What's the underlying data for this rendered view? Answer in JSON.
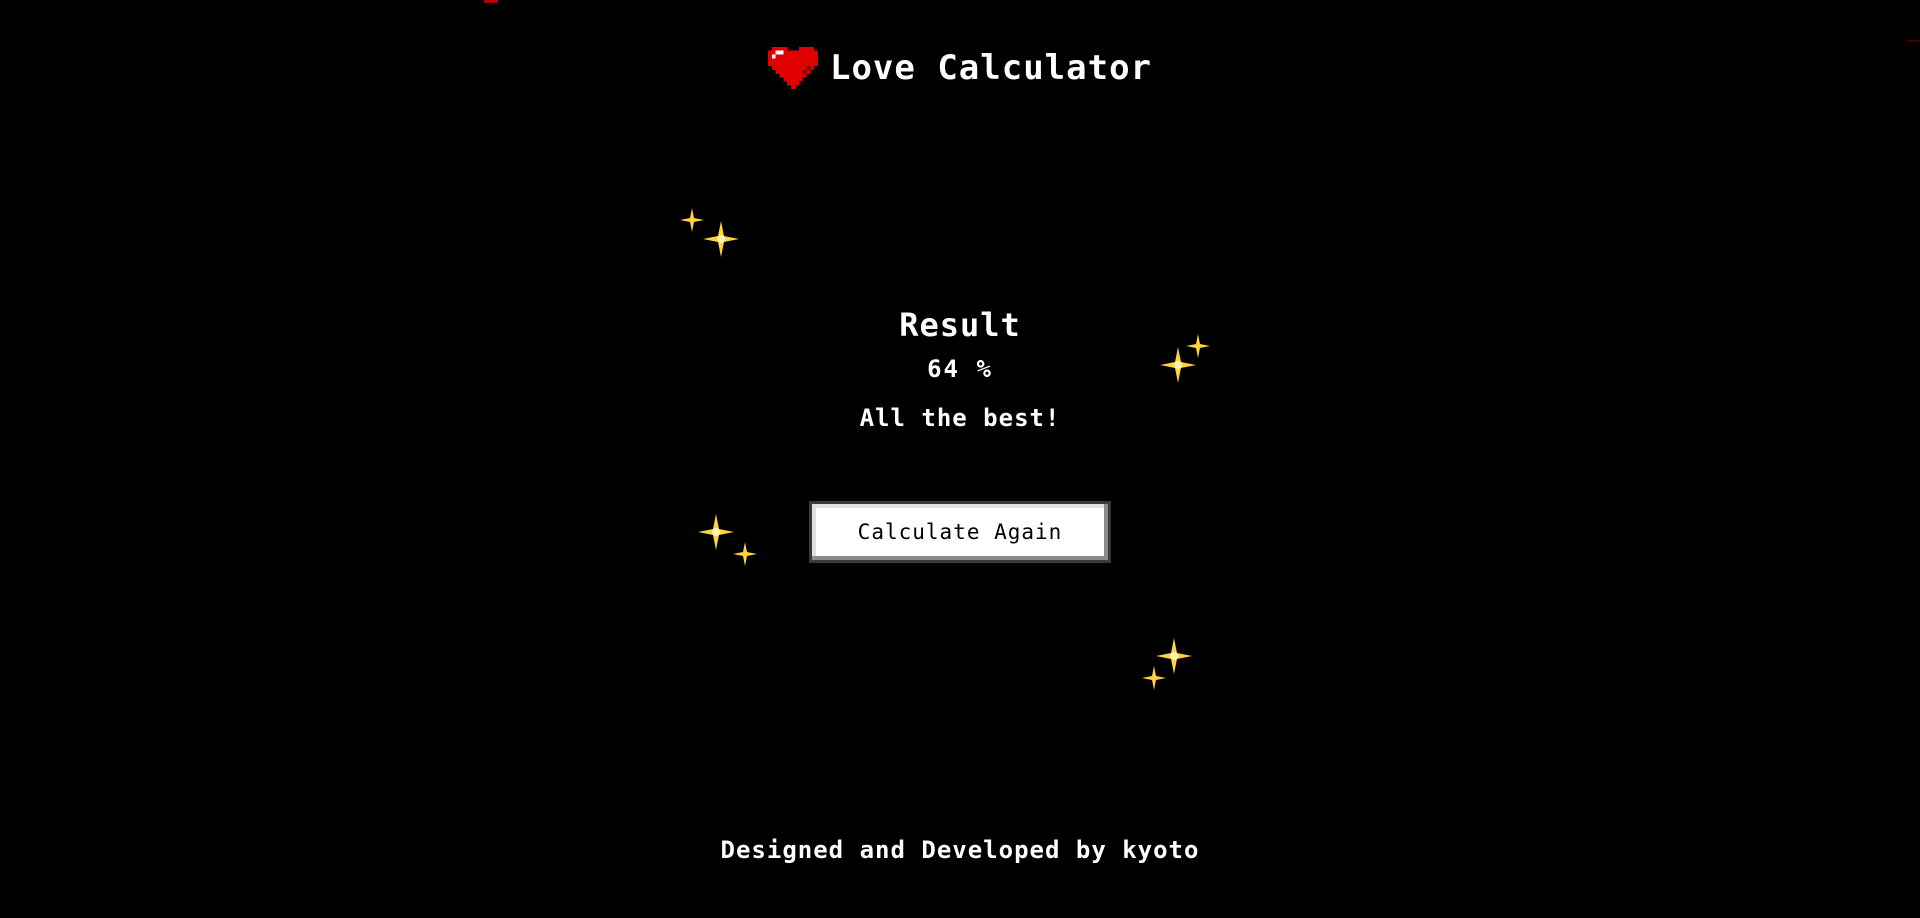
{
  "header": {
    "title": "Love Calculator",
    "icon": "heart-icon"
  },
  "result": {
    "heading": "Result",
    "value": "64 %",
    "message": "All the best!"
  },
  "actions": {
    "again_label": "Calculate Again"
  },
  "footer": {
    "credit": "Designed and Developed by kyoto"
  },
  "colors": {
    "background": "#000000",
    "text": "#ffffff",
    "heart": "#e00000",
    "sparkle": "#ffd23f"
  }
}
